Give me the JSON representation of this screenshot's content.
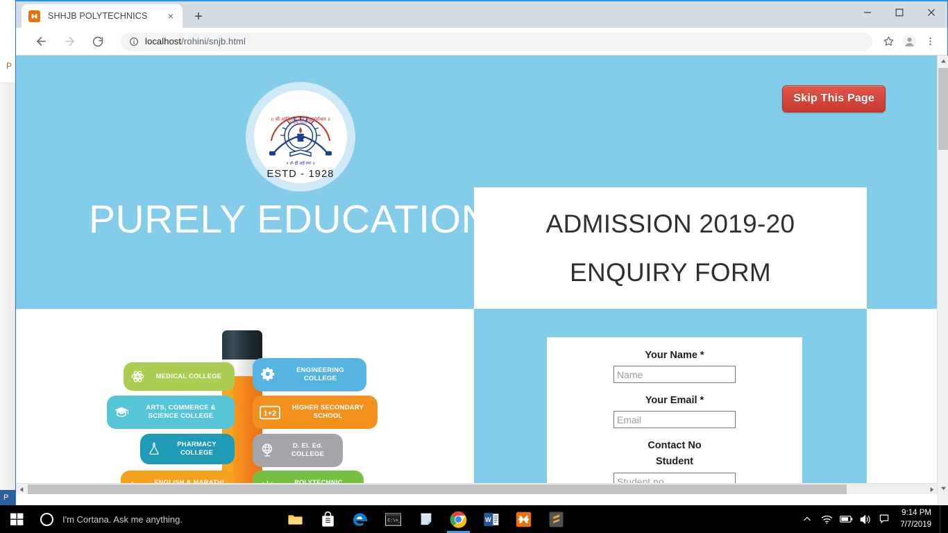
{
  "browser": {
    "tab": {
      "title": "SHHJB POLYTECHNICS",
      "favicon": "xampp-icon",
      "close_label": "×"
    },
    "new_tab_label": "+",
    "window_controls": {
      "minimize": "minimize-icon",
      "maximize": "maximize-icon",
      "close": "close-icon"
    },
    "nav": {
      "back": "back-arrow-icon",
      "forward": "forward-arrow-icon",
      "reload": "reload-icon"
    },
    "omnibox": {
      "info_icon": "site-info-icon",
      "host": "localhost",
      "path": "/rohini/snjb.html",
      "full_url": "localhost/rohini/snjb.html"
    },
    "actions": {
      "bookmark": "star-icon",
      "profile": "avatar-icon",
      "menu": "three-dot-menu-icon"
    }
  },
  "page": {
    "skip_button": "Skip This Page",
    "logo": {
      "estd_text": "ESTD - 1928",
      "alt": "snjb-trust-emblem"
    },
    "headline": "PURELY EDUCATION",
    "title_card": {
      "line1": "ADMISSION 2019-20",
      "line2": "ENQUIRY FORM"
    },
    "form": {
      "fields": [
        {
          "label": "Your Name *",
          "placeholder": "Name",
          "value": "",
          "name": "name-field"
        },
        {
          "label": "Your Email *",
          "placeholder": "Email",
          "value": "",
          "name": "email-field"
        }
      ],
      "contact_heading": "Contact No",
      "student_label": "Student",
      "student_placeholder": "Student no"
    },
    "infographic": {
      "left": [
        {
          "label": "MEDICAL COLLEGE",
          "icon": "atom-icon",
          "color": "#aacd52"
        },
        {
          "label": "ARTS, COMMERCE & SCIENCE COLLEGE",
          "icon": "graduation-cap-icon",
          "color": "#56c5d8"
        },
        {
          "label": "PHARMACY COLLEGE",
          "icon": "flask-icon",
          "color": "#1f9bb8"
        },
        {
          "label": "ENGLISH & MARATHI MEDIUM SCHOOL",
          "icon": "abc-icon",
          "color": "#f5a11e"
        }
      ],
      "right": [
        {
          "label": "ENGINEERING COLLEGE",
          "icon": "gears-icon",
          "color": "#56b4e0"
        },
        {
          "label": "HIGHER SECONDARY SCHOOL",
          "icon": "one-plus-two-icon",
          "color": "#f2911e"
        },
        {
          "label": "D. El. Ed. COLLEGE",
          "icon": "globe-icon",
          "color": "#a3a5a8"
        },
        {
          "label": "POLYTECHNIC COLLEGE",
          "icon": "lightbulb-icon",
          "color": "#76bf43"
        }
      ],
      "center_graphic": "pencil-illustration"
    },
    "theme": {
      "hero_blue": "#84cdea",
      "skip_red": "#d6483c",
      "card_white": "#ffffff"
    }
  },
  "scrollbars": {
    "vertical": {
      "up": "scroll-up-arrow-icon",
      "down": "scroll-down-arrow-icon"
    },
    "horizontal": {
      "left": "scroll-left-arrow-icon",
      "right": "scroll-right-arrow-icon"
    }
  },
  "background_window": {
    "label": "P",
    "taskbar_label": "P"
  },
  "taskbar": {
    "start": "windows-start-icon",
    "cortana_placeholder": "I'm Cortana. Ask me anything.",
    "pinned": [
      {
        "name": "file-explorer-icon"
      },
      {
        "name": "microsoft-store-icon"
      },
      {
        "name": "edge-browser-icon"
      },
      {
        "name": "command-prompt-icon"
      },
      {
        "name": "sticky-notes-icon"
      },
      {
        "name": "google-chrome-icon"
      },
      {
        "name": "microsoft-word-icon"
      },
      {
        "name": "xampp-icon"
      },
      {
        "name": "sublime-text-icon"
      }
    ],
    "tray": [
      {
        "name": "show-hidden-icons-chevron"
      },
      {
        "name": "wifi-icon"
      },
      {
        "name": "battery-icon"
      },
      {
        "name": "volume-icon"
      },
      {
        "name": "action-center-icon"
      }
    ],
    "clock": {
      "time": "9:14 PM",
      "date": "7/7/2019"
    }
  }
}
